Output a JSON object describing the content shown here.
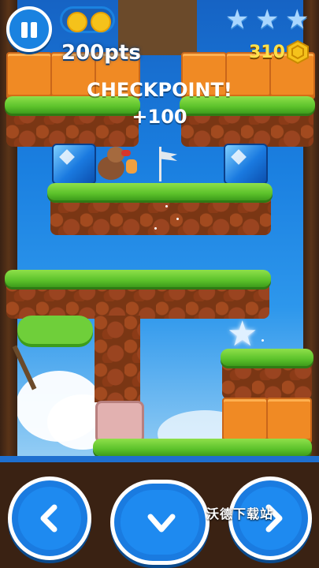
{
  "hud": {
    "points": "200pts",
    "coins": "310",
    "stars_total": 3,
    "coins_collected_icons": 2
  },
  "popup": {
    "title": "CHECKPOINT!",
    "bonus": "+100"
  },
  "watermark": "沃德下载站",
  "icons": [
    "pause-icon",
    "coin-icon",
    "star-icon",
    "hexagon-coin-icon",
    "chevron-left-icon",
    "chevron-down-icon",
    "chevron-right-icon",
    "checkpoint-flag-icon"
  ],
  "colors": {
    "sky_top": "#1663c4",
    "button_blue": "#1a7be0",
    "coin_gold": "#f5c21b",
    "grass": "#5cc22b",
    "brick": "#f08a24"
  }
}
